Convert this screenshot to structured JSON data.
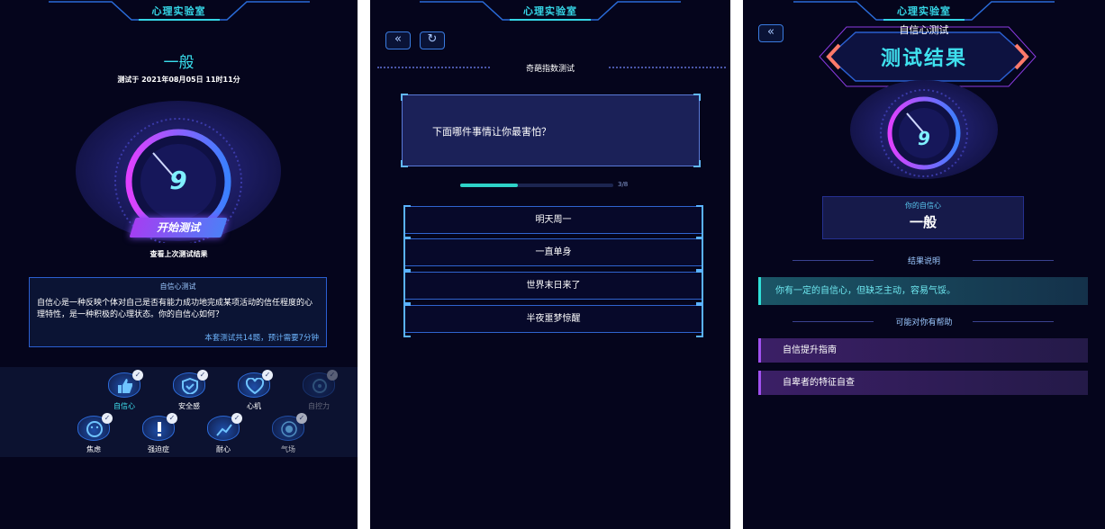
{
  "header_title": "心理实验室",
  "panel1": {
    "level": "一般",
    "date": "测试于 2021年08月05日 11时11分",
    "score": "9",
    "start_button": "开始测试",
    "last_result_link": "查看上次测试结果",
    "intro_title": "自信心测试",
    "intro_text": "自信心是一种反映个体对自己是否有能力成功地完成某项活动的信任程度的心理特性，是一种积极的心理状态。你的自信心如何？",
    "intro_note": "本套测试共14题，预计需要7分钟",
    "categories": [
      {
        "label": "自信心",
        "icon": "thumbs-up-icon"
      },
      {
        "label": "安全感",
        "icon": "shield-icon"
      },
      {
        "label": "心机",
        "icon": "heart-icon"
      },
      {
        "label": "自控力",
        "icon": "target-icon"
      },
      {
        "label": "焦虑",
        "icon": "face-icon"
      },
      {
        "label": "强迫症",
        "icon": "exclamation-icon"
      },
      {
        "label": "耐心",
        "icon": "growth-icon"
      },
      {
        "label": "气场",
        "icon": "aura-icon"
      }
    ]
  },
  "panel2": {
    "back_icon": "«",
    "refresh_icon": "↻",
    "section_title": "奇葩指数测试",
    "question": "下面哪件事情让你最害怕？",
    "progress_text": "3/8",
    "progress": 0.375,
    "options": [
      "明天周一",
      "一直单身",
      "世界末日来了",
      "半夜噩梦惊醒"
    ]
  },
  "panel3": {
    "back_icon": "«",
    "subtitle": "自信心测试",
    "title": "测试结果",
    "score": "9",
    "your_label": "你的自信心",
    "level": "一般",
    "explain_title": "结果说明",
    "explain_text": "你有一定的自信心，但缺乏主动，容易气馁。",
    "help_title": "可能对你有帮助",
    "help_items": [
      "自信提升指南",
      "自卑者的特征自查"
    ]
  },
  "colors": {
    "accent": "#3fe0ee",
    "background": "#05051c",
    "purple": "#a43ef2"
  }
}
